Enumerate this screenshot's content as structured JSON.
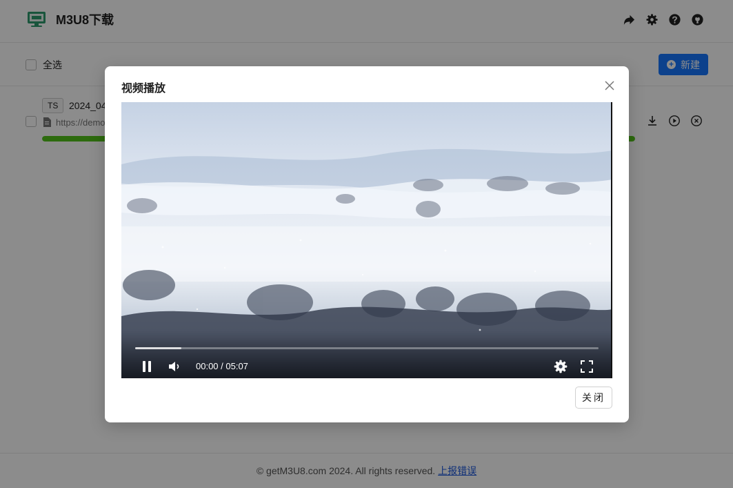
{
  "header": {
    "title": "M3U8下载",
    "logo_icon": "monitor-logo-icon",
    "icons": [
      "share-icon",
      "gear-icon",
      "help-icon",
      "github-icon"
    ]
  },
  "toolbar": {
    "select_all_label": "全选",
    "new_button_label": "新建"
  },
  "task": {
    "type_tag": "TS",
    "name": "2024_04",
    "url": "https://demo",
    "progress": 1.0,
    "actions": [
      "download-icon",
      "play-icon",
      "remove-icon"
    ]
  },
  "footer": {
    "copyright": "© getM3U8.com 2024. All rights reserved.",
    "report_link": "上报错误"
  },
  "modal": {
    "title": "视频播放",
    "close_button_label": "关闭",
    "player": {
      "time_display": "00:00 / 05:07",
      "buffered_fraction": 0.1,
      "played_fraction": 0.0
    }
  },
  "colors": {
    "primary": "#1677ff",
    "progress": "#52c41a",
    "link": "#1a56db"
  }
}
